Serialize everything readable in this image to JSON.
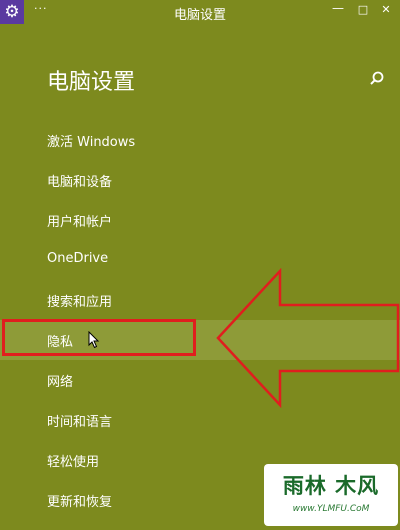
{
  "window": {
    "title": "电脑设置",
    "menu_dots": "···",
    "minimize": "—",
    "maximize": "□",
    "close": "✕",
    "app_icon": "gear-icon"
  },
  "page": {
    "title": "电脑设置",
    "search_icon": "search-icon"
  },
  "nav": {
    "items": [
      {
        "label": "激活 Windows"
      },
      {
        "label": "电脑和设备"
      },
      {
        "label": "用户和帐户"
      },
      {
        "label": "OneDrive"
      },
      {
        "label": "搜索和应用"
      },
      {
        "label": "隐私"
      },
      {
        "label": "网络"
      },
      {
        "label": "时间和语言"
      },
      {
        "label": "轻松使用"
      },
      {
        "label": "更新和恢复"
      }
    ],
    "selected_index": 5
  },
  "annotation": {
    "highlight_color": "#e01e1e"
  },
  "watermark": {
    "main": "雨林 木风",
    "sub": "www.YLMFU.CoM"
  },
  "colors": {
    "background": "#7d8a1e",
    "selected_row": "#8e9b38",
    "app_icon_bg": "#5a3aa0",
    "text": "#ffffff"
  }
}
